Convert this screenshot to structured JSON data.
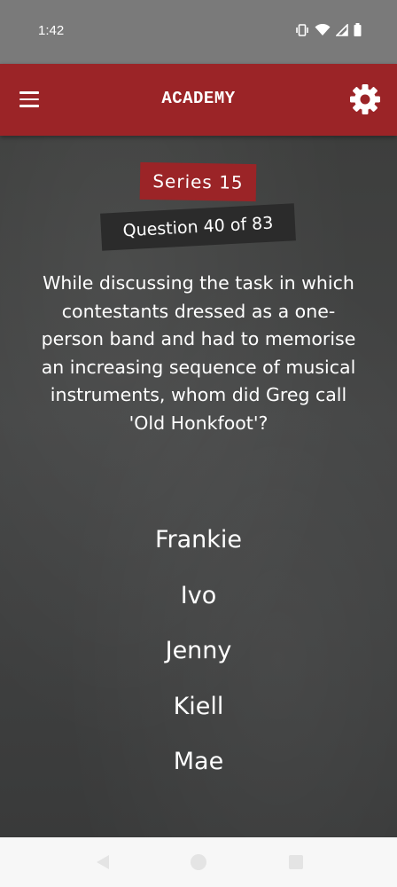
{
  "status_bar": {
    "time": "1:42",
    "icons": [
      "vibrate-icon",
      "wifi-icon",
      "signal-icon",
      "battery-icon"
    ]
  },
  "app_bar": {
    "title": "ACADEMY",
    "menu_icon": "menu-icon",
    "settings_icon": "gear-icon",
    "color": "#9b2427"
  },
  "quiz": {
    "series_label": "Series 15",
    "question_label": "Question 40 of 83",
    "question_text": "While discussing the task in which contestants dressed as a one-person band and had to memorise an increasing sequence of musical instruments, whom did Greg call 'Old Honkfoot'?",
    "answers": [
      "Frankie",
      "Ivo",
      "Jenny",
      "Kiell",
      "Mae"
    ]
  },
  "nav_bar": {
    "icons": [
      "back-icon",
      "home-icon",
      "recents-icon"
    ]
  }
}
